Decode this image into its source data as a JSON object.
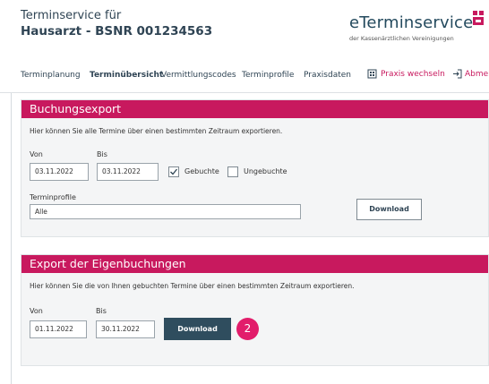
{
  "header": {
    "title_line1": "Terminservice für",
    "title_line2": "Hausarzt - BSNR 001234563",
    "brand_name": "eTerminservice",
    "brand_sub": "der Kassenärztlichen Vereinigungen",
    "brand_color": "#244a5e",
    "accent_color": "#c8195e"
  },
  "nav": {
    "items": [
      "Terminplanung",
      "Terminübersicht",
      "Vermittlungscodes",
      "Terminprofile",
      "Praxisdaten"
    ],
    "active": "Terminübersicht",
    "switch_label": "Praxis wechseln",
    "logout_label": "Abmelde"
  },
  "booking_export": {
    "title": "Buchungsexport",
    "description": "Hier können Sie alle Termine über einen bestimmten Zeitraum exportieren.",
    "from_label": "Von",
    "from_value": "03.11.2022",
    "to_label": "Bis",
    "to_value": "03.11.2022",
    "booked_label": "Gebuchte",
    "booked_checked": true,
    "unbooked_label": "Ungebuchte",
    "unbooked_checked": false,
    "profiles_label": "Terminprofile",
    "profiles_value": "Alle",
    "download_label": "Download"
  },
  "own_export": {
    "title": "Export der Eigenbuchungen",
    "description": "Hier können Sie die von Ihnen gebuchten Termine über einen bestimmten Zeitraum exportieren.",
    "from_label": "Von",
    "from_value": "01.11.2022",
    "to_label": "Bis",
    "to_value": "30.11.2022",
    "download_label": "Download",
    "step_number": "2"
  }
}
